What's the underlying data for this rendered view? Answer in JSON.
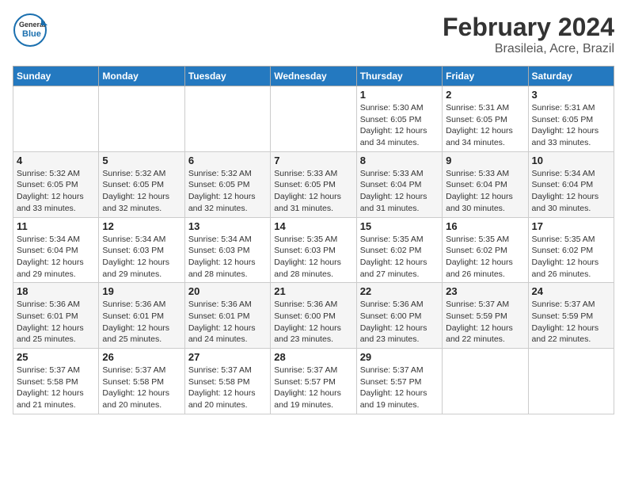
{
  "logo": {
    "general": "General",
    "blue": "Blue"
  },
  "title": "February 2024",
  "subtitle": "Brasileia, Acre, Brazil",
  "headers": [
    "Sunday",
    "Monday",
    "Tuesday",
    "Wednesday",
    "Thursday",
    "Friday",
    "Saturday"
  ],
  "weeks": [
    [
      {
        "day": "",
        "info": ""
      },
      {
        "day": "",
        "info": ""
      },
      {
        "day": "",
        "info": ""
      },
      {
        "day": "",
        "info": ""
      },
      {
        "day": "1",
        "info": "Sunrise: 5:30 AM\nSunset: 6:05 PM\nDaylight: 12 hours\nand 34 minutes."
      },
      {
        "day": "2",
        "info": "Sunrise: 5:31 AM\nSunset: 6:05 PM\nDaylight: 12 hours\nand 34 minutes."
      },
      {
        "day": "3",
        "info": "Sunrise: 5:31 AM\nSunset: 6:05 PM\nDaylight: 12 hours\nand 33 minutes."
      }
    ],
    [
      {
        "day": "4",
        "info": "Sunrise: 5:32 AM\nSunset: 6:05 PM\nDaylight: 12 hours\nand 33 minutes."
      },
      {
        "day": "5",
        "info": "Sunrise: 5:32 AM\nSunset: 6:05 PM\nDaylight: 12 hours\nand 32 minutes."
      },
      {
        "day": "6",
        "info": "Sunrise: 5:32 AM\nSunset: 6:05 PM\nDaylight: 12 hours\nand 32 minutes."
      },
      {
        "day": "7",
        "info": "Sunrise: 5:33 AM\nSunset: 6:05 PM\nDaylight: 12 hours\nand 31 minutes."
      },
      {
        "day": "8",
        "info": "Sunrise: 5:33 AM\nSunset: 6:04 PM\nDaylight: 12 hours\nand 31 minutes."
      },
      {
        "day": "9",
        "info": "Sunrise: 5:33 AM\nSunset: 6:04 PM\nDaylight: 12 hours\nand 30 minutes."
      },
      {
        "day": "10",
        "info": "Sunrise: 5:34 AM\nSunset: 6:04 PM\nDaylight: 12 hours\nand 30 minutes."
      }
    ],
    [
      {
        "day": "11",
        "info": "Sunrise: 5:34 AM\nSunset: 6:04 PM\nDaylight: 12 hours\nand 29 minutes."
      },
      {
        "day": "12",
        "info": "Sunrise: 5:34 AM\nSunset: 6:03 PM\nDaylight: 12 hours\nand 29 minutes."
      },
      {
        "day": "13",
        "info": "Sunrise: 5:34 AM\nSunset: 6:03 PM\nDaylight: 12 hours\nand 28 minutes."
      },
      {
        "day": "14",
        "info": "Sunrise: 5:35 AM\nSunset: 6:03 PM\nDaylight: 12 hours\nand 28 minutes."
      },
      {
        "day": "15",
        "info": "Sunrise: 5:35 AM\nSunset: 6:02 PM\nDaylight: 12 hours\nand 27 minutes."
      },
      {
        "day": "16",
        "info": "Sunrise: 5:35 AM\nSunset: 6:02 PM\nDaylight: 12 hours\nand 26 minutes."
      },
      {
        "day": "17",
        "info": "Sunrise: 5:35 AM\nSunset: 6:02 PM\nDaylight: 12 hours\nand 26 minutes."
      }
    ],
    [
      {
        "day": "18",
        "info": "Sunrise: 5:36 AM\nSunset: 6:01 PM\nDaylight: 12 hours\nand 25 minutes."
      },
      {
        "day": "19",
        "info": "Sunrise: 5:36 AM\nSunset: 6:01 PM\nDaylight: 12 hours\nand 25 minutes."
      },
      {
        "day": "20",
        "info": "Sunrise: 5:36 AM\nSunset: 6:01 PM\nDaylight: 12 hours\nand 24 minutes."
      },
      {
        "day": "21",
        "info": "Sunrise: 5:36 AM\nSunset: 6:00 PM\nDaylight: 12 hours\nand 23 minutes."
      },
      {
        "day": "22",
        "info": "Sunrise: 5:36 AM\nSunset: 6:00 PM\nDaylight: 12 hours\nand 23 minutes."
      },
      {
        "day": "23",
        "info": "Sunrise: 5:37 AM\nSunset: 5:59 PM\nDaylight: 12 hours\nand 22 minutes."
      },
      {
        "day": "24",
        "info": "Sunrise: 5:37 AM\nSunset: 5:59 PM\nDaylight: 12 hours\nand 22 minutes."
      }
    ],
    [
      {
        "day": "25",
        "info": "Sunrise: 5:37 AM\nSunset: 5:58 PM\nDaylight: 12 hours\nand 21 minutes."
      },
      {
        "day": "26",
        "info": "Sunrise: 5:37 AM\nSunset: 5:58 PM\nDaylight: 12 hours\nand 20 minutes."
      },
      {
        "day": "27",
        "info": "Sunrise: 5:37 AM\nSunset: 5:58 PM\nDaylight: 12 hours\nand 20 minutes."
      },
      {
        "day": "28",
        "info": "Sunrise: 5:37 AM\nSunset: 5:57 PM\nDaylight: 12 hours\nand 19 minutes."
      },
      {
        "day": "29",
        "info": "Sunrise: 5:37 AM\nSunset: 5:57 PM\nDaylight: 12 hours\nand 19 minutes."
      },
      {
        "day": "",
        "info": ""
      },
      {
        "day": "",
        "info": ""
      }
    ]
  ]
}
